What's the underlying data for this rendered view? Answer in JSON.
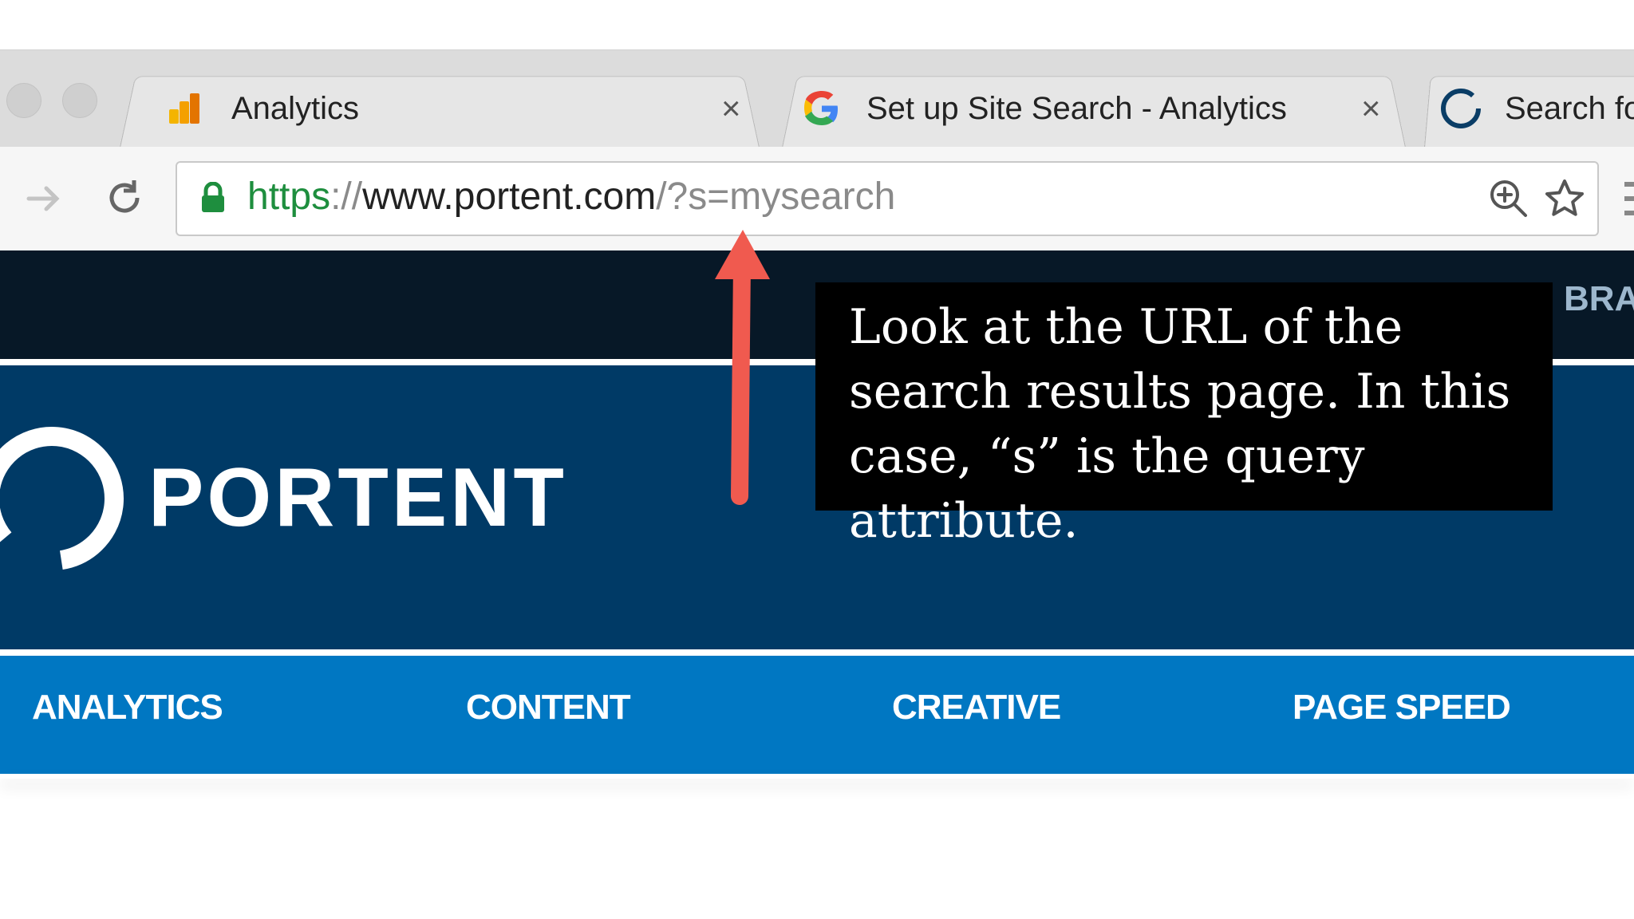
{
  "browser": {
    "tabs": [
      {
        "title": "Analytics",
        "icon": "google-analytics-icon"
      },
      {
        "title": "Set up Site Search - Analytics",
        "icon": "google-g-icon"
      },
      {
        "title": "Search fo",
        "icon": "portent-circle-icon"
      }
    ],
    "close_glyph": "×",
    "url": {
      "scheme": "https",
      "slashes": "://",
      "host": "www.portent.com",
      "path": "/?s=mysearch"
    },
    "icons": [
      "forward-icon",
      "reload-icon",
      "lock-icon",
      "zoom-icon",
      "bookmark-star-icon",
      "menu-icon"
    ]
  },
  "site": {
    "top_nav_partial": "BRA",
    "brand": "PORTENT",
    "nav": [
      "ANALYTICS",
      "CONTENT",
      "CREATIVE",
      "PAGE SPEED"
    ],
    "colors": {
      "top": "#071827",
      "hero": "#003a66",
      "nav": "#0077c2"
    }
  },
  "annotation": {
    "text": "Look at the URL of the search results page. In this case, “s” is the query attribute.",
    "arrow_color": "#f05a4f"
  }
}
